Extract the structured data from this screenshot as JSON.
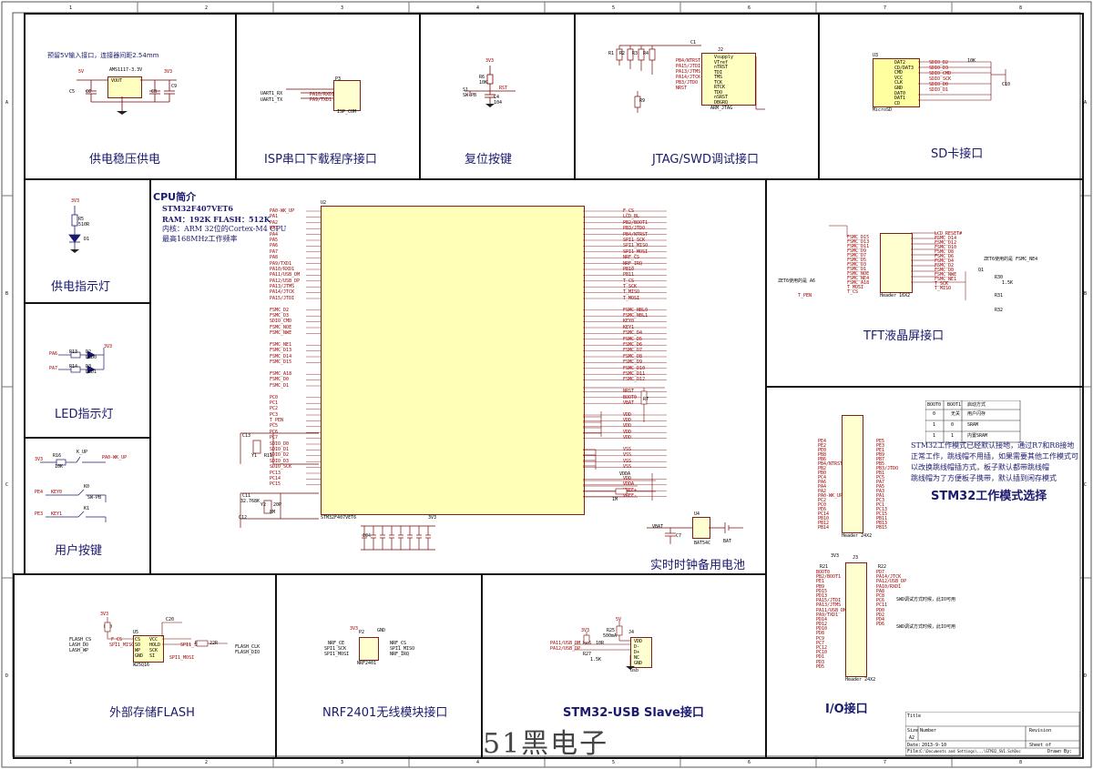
{
  "frame": {
    "cols": [
      "1",
      "2",
      "3",
      "4",
      "5",
      "6",
      "7",
      "8"
    ],
    "rows": [
      "A",
      "B",
      "C",
      "D"
    ]
  },
  "blocks": {
    "power": {
      "title": "供电稳压供电",
      "note": "预留5V输入接口，连接器间距2.54mm",
      "chip": "AMS1117-3.3V",
      "refs": [
        "U1",
        "C5",
        "C6",
        "C8",
        "C9",
        "5V",
        "3V3",
        "VOUT",
        "VIN",
        "GND"
      ]
    },
    "isp": {
      "title": "ISP串口下载程序接口",
      "pins": [
        "UART1_RX",
        "UART1_TX"
      ],
      "nets": [
        "PA10/RXD1",
        "PA9/TXD1"
      ],
      "conn": "ISP_COM",
      "refs": [
        "P3"
      ]
    },
    "reset": {
      "title": "复位按键",
      "refs": [
        "R6",
        "C4",
        "S1",
        "RST",
        "3V3",
        "10K",
        "SW-PB",
        "104"
      ]
    },
    "jtag": {
      "title": "JTAG/SWD调试接口",
      "conn": "ARM_JTAG",
      "pins": [
        "Vsupply",
        "VTref",
        "nTRST",
        "TDI",
        "TMS",
        "TCK",
        "RTCK",
        "TDO",
        "nSRST",
        "DBGRQ",
        "DBGACK",
        "GND",
        "GND",
        "GND",
        "GND",
        "GND",
        "GND",
        "GND",
        "GND"
      ],
      "nets": [
        "PB4/NTRST",
        "PA15/JTDI",
        "PA13/JTMS",
        "PA14/JTCK",
        "PB3/JTDO",
        "NRST"
      ],
      "refs": [
        "R1",
        "R2",
        "R3",
        "R4",
        "R5",
        "R9",
        "C1",
        "J2",
        "10K"
      ]
    },
    "sd": {
      "title": "SD卡接口",
      "conn": "MicroSD",
      "pins": [
        "DAT2",
        "CD/DAT3",
        "CMD",
        "VCC",
        "CLK",
        "GND",
        "DAT0",
        "DAT1",
        "CD"
      ],
      "nets": [
        "SDIO_D2",
        "SDIO_D3",
        "SDIO_CMD",
        "SDIO_SCK",
        "SDIO_D0",
        "SDIO_D1"
      ],
      "refs": [
        "U3",
        "R12",
        "R13",
        "R14",
        "R15",
        "R16",
        "C10",
        "10K",
        "22R"
      ]
    },
    "cpu": {
      "heading": "CPU简介",
      "lines": [
        "STM32F407VET6",
        "RAM：192K      FLASH：512K",
        "内核：ARM 32位的Cortex-M4 CPU",
        "最高168MHz工作频率"
      ],
      "part": "STM32F407VET6",
      "left_pins": [
        "PA0-WK_UP",
        "PA1",
        "PA2",
        "PA3",
        "PA4",
        "PA5",
        "PA6",
        "PA7",
        "PA8",
        "PA9/TXD1",
        "PA10/RXD1",
        "PA11/USB_DM",
        "PA12/USB_DP",
        "PA13/JTMS",
        "PA14/JTCK",
        "PA15/JTDI",
        "",
        "FSMC_D2",
        "FSMC_D3",
        "SDIO_CMD",
        "FSMC_NOE",
        "FSMC_NWE",
        "",
        "FSMC_NE1",
        "FSMC_D13",
        "FSMC_D14",
        "FSMC_D15",
        "",
        "FSMC_A18",
        "FSMC_D0",
        "FSMC_D1",
        "",
        "PC0",
        "PC1",
        "PC2",
        "PC3",
        "T_PEN",
        "PC5",
        "PC6",
        "PC7",
        "SDIO_D0",
        "SDIO_D1",
        "SDIO_D2",
        "SDIO_D3",
        "SDIO_SCK",
        "PC13",
        "PC14",
        "PC15"
      ],
      "right_pins": [
        "F_CS",
        "LCD_BL",
        "PB2/BOOT1",
        "PB3/JTDO",
        "PB4/NTRST",
        "SPI1_SCK",
        "SPI1_MISO",
        "SPI1_MOSI",
        "NRF_CS",
        "NRF_IRQ",
        "PB10",
        "PB11",
        "T_CS",
        "T_SCK",
        "T_MISO",
        "T_MOSI",
        "",
        "FSMC_NBL0",
        "FSMC_NBL1",
        "KEY0",
        "KEY1",
        "FSMC_D4",
        "FSMC_D5",
        "FSMC_D6",
        "FSMC_D7",
        "FSMC_D8",
        "FSMC_D9",
        "FSMC_D10",
        "FSMC_D11",
        "FSMC_D12",
        "",
        "NRST",
        "BOOT0",
        "VBAT",
        "",
        "VDD",
        "VDD",
        "VDD",
        "VDD",
        "VDD",
        "",
        "VSS",
        "VSS",
        "VSS",
        "VSS",
        "",
        "VDD",
        "VDDA",
        "VREF+",
        "VREF-"
      ],
      "refs": [
        "U2",
        "Y1",
        "Y2",
        "C7",
        "C11",
        "C12",
        "C13",
        "C14",
        "C15",
        "C16",
        "C17",
        "C18",
        "C19",
        "R10",
        "R11",
        "8M",
        "32.768K",
        "20P",
        "1M",
        "104"
      ],
      "battery_label": "实时时钟备用电池",
      "battery_refs": [
        "VBAT",
        "BAT54C",
        "BAT",
        "U4",
        "C7"
      ]
    },
    "tft": {
      "title": "TFT液晶屏接口",
      "conn": "Header 16X2",
      "nets": [
        "FSMC_D15",
        "FSMC_D13",
        "FSMC_D11",
        "FSMC_D9",
        "FSMC_D7",
        "FSMC_D5",
        "FSMC_D3",
        "FSMC_D1",
        "FSMC_NOE",
        "FSMC_NE4",
        "FSMC_A18",
        "T_MOSI",
        "T_CS",
        "LCD_RESET#",
        "FSMC_D14",
        "FSMC_D12",
        "FSMC_D10",
        "FSMC_D8",
        "FSMC_D6",
        "FSMC_D4",
        "FSMC_D2",
        "FSMC_D0",
        "FSMC_NWE",
        "FSMC_NE1",
        "T_SCK",
        "T_MISO",
        "T_PEN",
        "LCD_BL"
      ],
      "note1": "ZET6使用的是 A6",
      "note2": "ZET6使用的是 FSMC_NE4",
      "refs": [
        "Q1",
        "R30",
        "R31",
        "R32",
        "1.5K",
        "10K"
      ]
    },
    "power_led": {
      "title": "供电指示灯",
      "refs": [
        "R5",
        "D1",
        "510R",
        "3V3"
      ]
    },
    "led": {
      "title": "LED指示灯",
      "nets": [
        "PA6",
        "PA7"
      ],
      "refs": [
        "R13",
        "R14",
        "D2",
        "D3",
        "LED0",
        "LED1",
        "510R",
        "3V3"
      ]
    },
    "keys": {
      "title": "用户按键",
      "nets": [
        "PA0-WK_UP",
        "PE4",
        "PE3"
      ],
      "labels": [
        "K_UP",
        "KEY0",
        "KEY1"
      ],
      "refs": [
        "R16",
        "K0",
        "K1",
        "K2",
        "10K",
        "SW-PB"
      ]
    },
    "boot": {
      "title": "STM32工作模式选择",
      "conn": "Header 24X2",
      "table_header": [
        "BOOT0",
        "BOOT1",
        "启动方式"
      ],
      "table_rows": [
        [
          "0",
          "无关",
          "用户闪存"
        ],
        [
          "1",
          "0",
          "SRAM"
        ],
        [
          "1",
          "1",
          "内置SRAM"
        ]
      ],
      "note": "STM32工作模式已经默认接地，通过R7和R8接地\n正常工作，跳线帽不用插，如果需要其他工作模式可\n以改换跳线帽插方式，板子默认都带跳线帽\n跳线帽为了方便板子携带，默认插到闲存模式",
      "pins": [
        "PE4",
        "PE2",
        "PE0",
        "PB8",
        "PB6",
        "PB4/NTRST",
        "PB2",
        "PB0",
        "PC4",
        "PA6",
        "PA4",
        "PA2",
        "PA0-WK_UP",
        "PC2",
        "PC0",
        "PE6",
        "PC14",
        "PB10",
        "PB12",
        "PB14",
        "PE5",
        "PE3",
        "PE1",
        "PB9",
        "PB7",
        "PB5",
        "PB3/JTDO",
        "PB1",
        "PC5",
        "PA7",
        "PA5",
        "PA3",
        "PA1",
        "PC3",
        "PC1",
        "PC13",
        "PC15",
        "PB11",
        "PB13",
        "PB15"
      ]
    },
    "io": {
      "title": "I/O接口",
      "conn": "Header 24X2",
      "notes": [
        "SWD调试方式时候，此IO可用",
        "SWD调试方式时候，此IO可用"
      ],
      "nets": [
        "BOOT0",
        "PB2/BOOT1",
        "PE1",
        "PB9",
        "PD15",
        "PD13",
        "PA15/JTDI",
        "PA13/JTMS",
        "PA11/USB_DM",
        "PA9/TXD1",
        "PD14",
        "PD12",
        "PD10",
        "PD8",
        "PC9",
        "PC7",
        "PC12",
        "PC10",
        "PD1",
        "PD3",
        "PD5",
        "PD7",
        "PA14/JTCK",
        "PA12/USB_DP",
        "PA10/RXD1",
        "PA8",
        "PC8",
        "PC6",
        "PC11",
        "PD0",
        "PD2",
        "PD4",
        "PD6"
      ],
      "refs": [
        "R21",
        "R22",
        "J3",
        "3V3",
        "10K"
      ]
    },
    "flash": {
      "title": "外部存储FLASH",
      "chip": "W25Q16",
      "nets": [
        "FLASH_CS",
        "LASH_DO",
        "LASH_WP",
        "SPI1_MISO",
        "SPI1_SCK",
        "SPI1_MOSI",
        "FLASH_CLK",
        "FLASH_DIO",
        "F_CS"
      ],
      "pins": [
        "CS",
        "SO",
        "WP",
        "GND",
        "VCC",
        "HOLD",
        "SCK",
        "SI"
      ],
      "refs": [
        "U5",
        "R20",
        "R22",
        "C20",
        "10K",
        "22R",
        "104",
        "3V3"
      ]
    },
    "nrf": {
      "title": "NRF2401无线模块接口",
      "conn": "NRF2401",
      "nets": [
        "NRF_CE",
        "SPI1_SCK",
        "SPI1_MOSI",
        "NRF_CS",
        "SPI1_MISO",
        "NRF_IRQ"
      ],
      "refs": [
        "P2",
        "3V3",
        "GND"
      ]
    },
    "usb": {
      "title": "STM32-USB Slave接口",
      "conn": "usb",
      "nets": [
        "PA11/USB_DM",
        "PA12/USB_DP"
      ],
      "pins": [
        "VDD",
        "D-",
        "D+",
        "NC",
        "GND"
      ],
      "refs": [
        "R25",
        "R26",
        "R27",
        "J4",
        "500mA",
        "1.5K",
        "10R",
        "22R",
        "3V3",
        "5V"
      ]
    }
  },
  "titleblock": {
    "title": "Title",
    "size": "Size",
    "size_val": "A2",
    "number": "Number",
    "revision": "Revision",
    "date": "Date:",
    "date_val": "2013-9-10",
    "sheet": "Sheet  of",
    "file": "File:",
    "file_val": "C:\\Documents and Settings\\...\\STM32_SV1.SchDoc",
    "drawn": "Drawn By:"
  },
  "watermark": "51黑电子"
}
